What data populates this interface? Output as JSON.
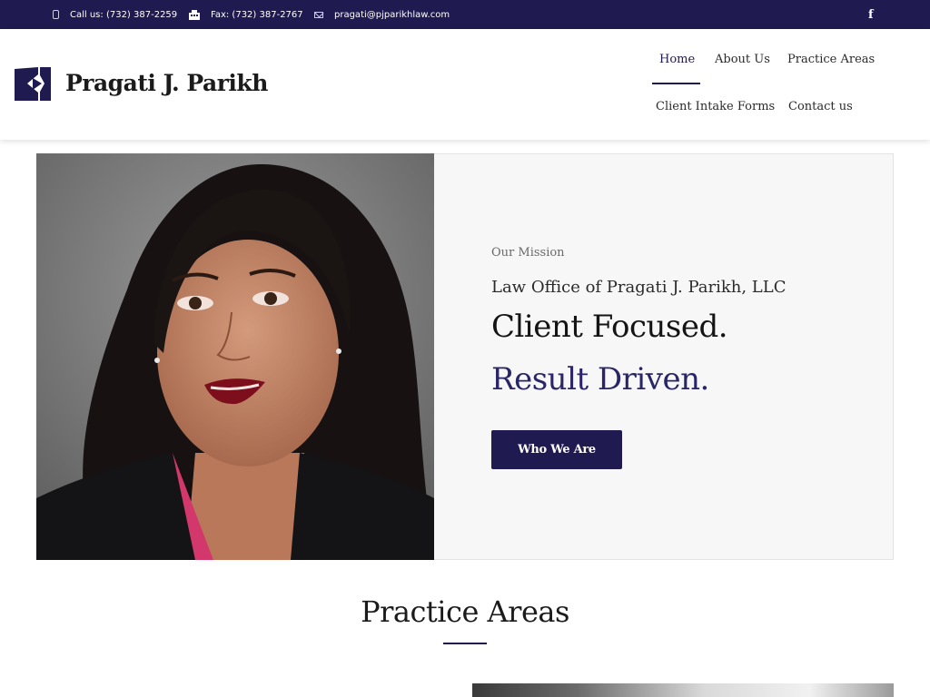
{
  "topbar": {
    "phone": "Call us: (732) 387-2259",
    "fax": "Fax: (732) 387-2767",
    "email": "pragati@pjparikhlaw.com",
    "social_icon": "facebook-icon",
    "social_glyph": "f"
  },
  "header": {
    "brand": "Pragati J. Parikh",
    "nav": [
      {
        "label": "Home",
        "active": true
      },
      {
        "label": "About Us"
      },
      {
        "label": "Practice Areas"
      },
      {
        "label": "Client Intake Forms"
      },
      {
        "label": "Contact us"
      }
    ]
  },
  "hero": {
    "eyebrow": "Our Mission",
    "firm": "Law Office of Pragati J. Parikh, LLC",
    "headline_1": "Client Focused.",
    "headline_2": "Result Driven.",
    "cta": "Who We Are"
  },
  "section": {
    "title": "Practice Areas"
  },
  "colors": {
    "brand": "#1f1a4f",
    "accent": "#2a2566",
    "panel_bg": "#f7f7f7"
  }
}
